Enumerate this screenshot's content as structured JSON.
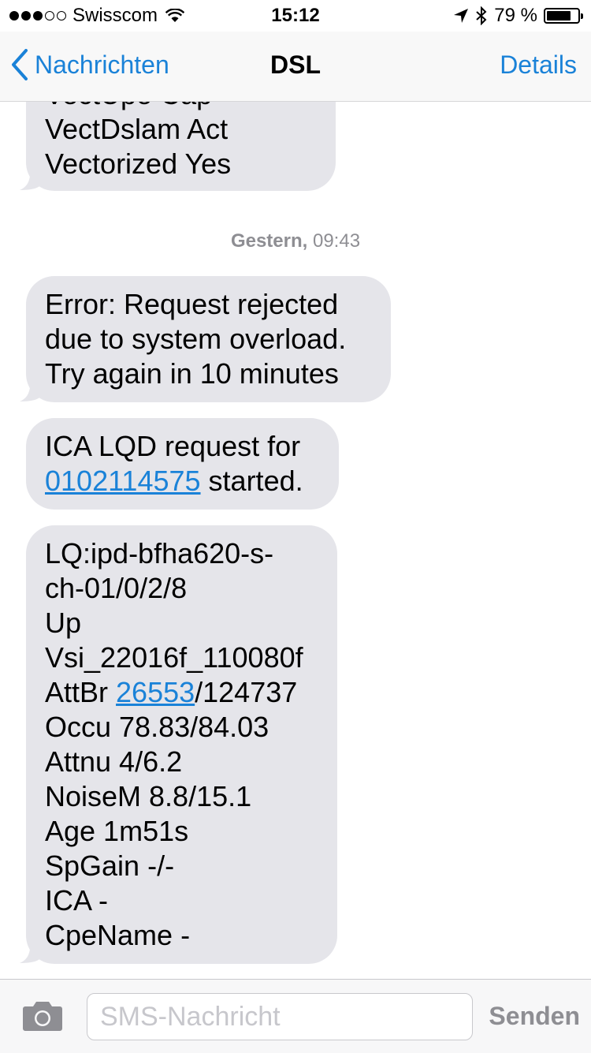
{
  "status_bar": {
    "signal_dots": 5,
    "signal_filled": 3,
    "carrier": "Swisscom",
    "wifi_icon": "wifi-icon",
    "time": "15:12",
    "location_icon": "location-arrow-icon",
    "bluetooth_icon": "bluetooth-icon",
    "battery_text": "79 %",
    "battery_level": 0.79
  },
  "nav": {
    "back_label": "Nachrichten",
    "title": "DSL",
    "details_label": "Details"
  },
  "messages": {
    "m1": {
      "lines": [
        "VectUpo Cap",
        "VectDslam Act",
        "Vectorized Yes"
      ]
    },
    "timestamp": {
      "day": "Gestern,",
      "time": "09:43"
    },
    "m2": {
      "lines": [
        "Error: Request rejected",
        "due to system overload.",
        "Try again in 10 minutes"
      ]
    },
    "m3": {
      "line1": "ICA LQD request for",
      "link": "0102114575",
      "line2_suffix": " started."
    },
    "m4": {
      "line1": "LQ:ipd-bfha620-s-",
      "line2": "ch-01/0/2/8",
      "line3": "Up",
      "line4": "Vsi_22016f_110080f",
      "line5_prefix": "AttBr ",
      "line5_link": "26553",
      "line5_suffix": "/124737",
      "line6": "Occu 78.83/84.03",
      "line7": "Attnu 4/6.2",
      "line8": "NoiseM 8.8/15.1",
      "line9": "Age 1m51s",
      "line10": "SpGain -/-",
      "line11": "ICA -",
      "line12": "CpeName -"
    }
  },
  "input_bar": {
    "camera_icon": "camera-icon",
    "placeholder": "SMS-Nachricht",
    "value": "",
    "send_label": "Senden"
  },
  "colors": {
    "accent": "#1a82d8",
    "bubble": "#e5e5ea",
    "timestamp": "#8e8e93"
  }
}
